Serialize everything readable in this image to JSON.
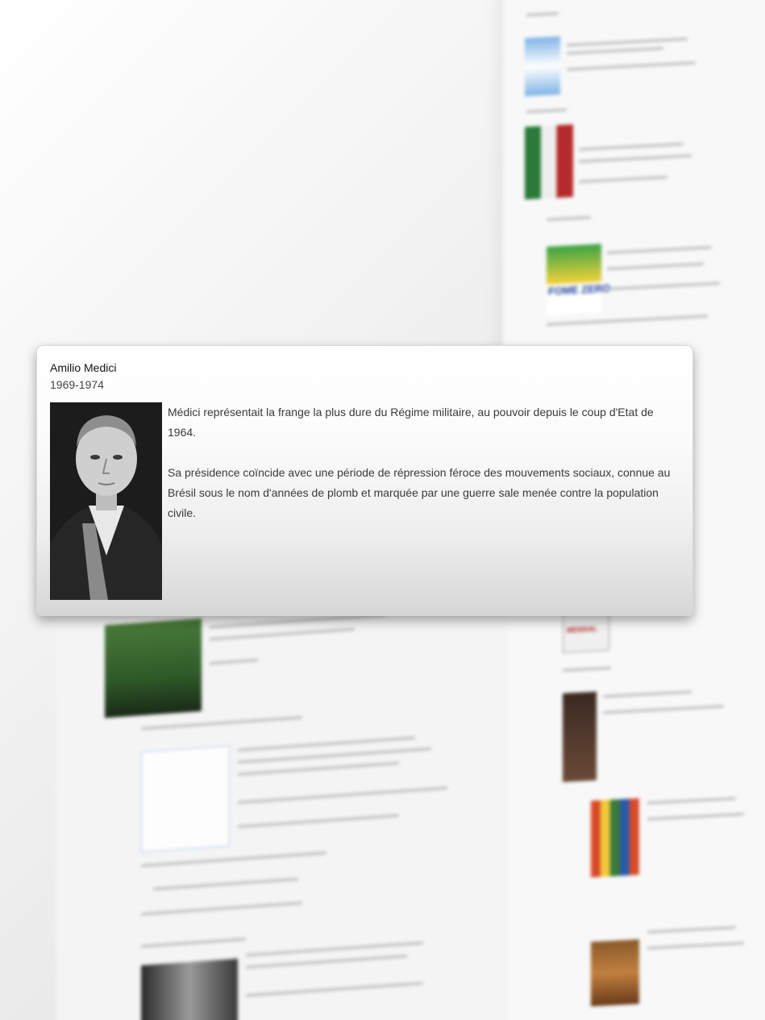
{
  "popup": {
    "name": "Amilio Medici",
    "years": "1969-1974",
    "paragraphs": [
      "Médici représentait la frange la plus dure du Régime militaire, au pouvoir depuis le coup d'Etat de 1964.",
      "Sa présidence coïncide avec une période de répression féroce des mouvements sociaux, connue au Brésil sous le nom d'années de plomb et marquée par une guerre sale menée contre la population civile."
    ]
  },
  "background": {
    "thumb_labels": {
      "fome_zero": "FOME ZERO",
      "mensal": "MENSAL"
    }
  }
}
